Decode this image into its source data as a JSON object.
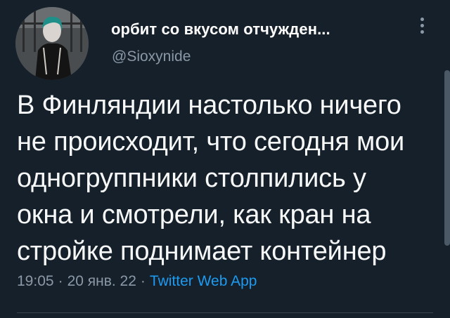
{
  "author": {
    "display_name": "орбит со вкусом отчужден...",
    "handle": "@Sioxynide"
  },
  "tweet": {
    "lines": [
      "В Финляндии настолько ничего",
      "не происходит, что сегодня мои",
      "одногруппники столпились у",
      "окна и смотрели, как кран на",
      "стройке поднимает контейнер"
    ],
    "time": "19:05",
    "date": "20 янв. 22",
    "source": "Twitter Web App"
  },
  "icons": {
    "more": "more-vertical-icon"
  },
  "colors": {
    "background": "#15202b",
    "text": "#f7f9f9",
    "secondary": "#8b98a5",
    "accent": "#1d9bf0"
  }
}
